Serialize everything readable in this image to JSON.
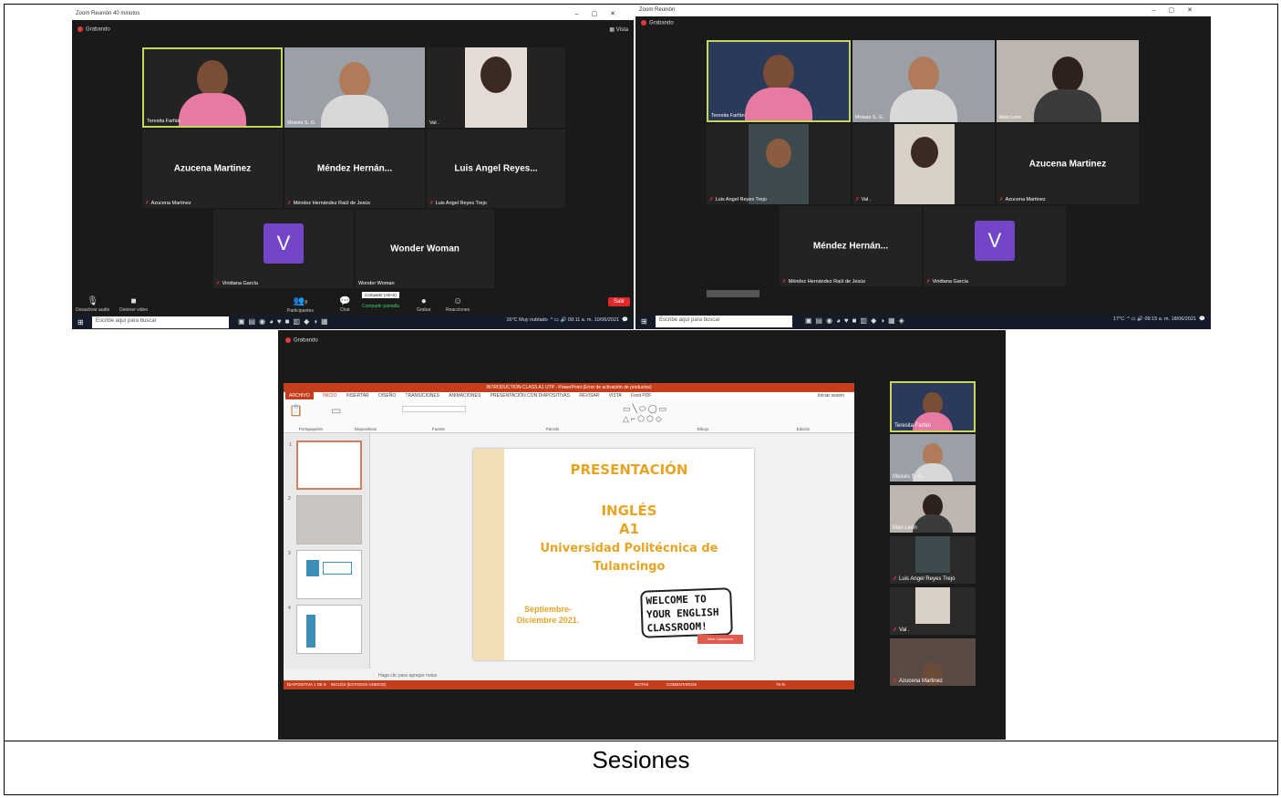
{
  "caption": "Sesiones",
  "screenshot_a": {
    "window_title": "Zoom Reunión 40 minutos",
    "recording": "Grabando",
    "view_label": "Vista",
    "participants": [
      {
        "name": "Teresita Farfán",
        "kind": "video",
        "active": true
      },
      {
        "name": "Moisés S. G.",
        "kind": "video"
      },
      {
        "name": "Val .",
        "kind": "video"
      },
      {
        "name": "Azucena Martinez",
        "display": "Azucena Martinez",
        "kind": "name"
      },
      {
        "name": "Méndez Hernández Raúl de Jesús",
        "display": "Méndez Hernán...",
        "kind": "name"
      },
      {
        "name": "Luis Angel Reyes Trejo",
        "display": "Luis Angel Reyes...",
        "kind": "name"
      },
      {
        "name": "Viridiana García",
        "display": "V",
        "kind": "avatar"
      },
      {
        "name": "Wonder Woman",
        "display": "Wonder Woman",
        "kind": "name"
      }
    ],
    "toolbar": {
      "audio": "Desactivar audio",
      "video": "Detener video",
      "participants": "Participantes",
      "participants_count": "8",
      "chat": "Chat",
      "share_tooltip": "Compartir (Alt+S)",
      "share": "Compartir pantalla",
      "record": "Grabar",
      "reactions": "Reacciones",
      "leave": "Salir"
    },
    "taskbar": {
      "search": "Escribe aquí para buscar",
      "weather": "16°C Muy nublado",
      "time": "09:11 a. m.",
      "date": "10/06/2021"
    }
  },
  "screenshot_b": {
    "window_title": "Zoom Reunión",
    "recording": "Grabando",
    "participants": [
      {
        "name": "Teresita Farfán",
        "kind": "video",
        "active": true
      },
      {
        "name": "Moisés S. G.",
        "kind": "video"
      },
      {
        "name": "Mari León",
        "kind": "video"
      },
      {
        "name": "Luis Angel Reyes Trejo",
        "kind": "video"
      },
      {
        "name": "Val .",
        "kind": "video"
      },
      {
        "name": "Azucena Martinez",
        "display": "Azucena Martinez",
        "kind": "name"
      },
      {
        "name": "Méndez Hernández Raúl de Jesús",
        "display": "Méndez Hernán...",
        "kind": "name"
      },
      {
        "name": "Viridiana García",
        "display": "V",
        "kind": "avatar"
      }
    ],
    "taskbar": {
      "search": "Escribe aquí para buscar",
      "weather": "17°C",
      "time": "09:15 a. m.",
      "date": "18/06/2021"
    }
  },
  "screenshot_c": {
    "recording": "Grabando",
    "ppt": {
      "title": "INTRODUCTION CLASS A1 UTP - PowerPoint (Error de activación de productos)",
      "tabs": [
        "ARCHIVO",
        "INICIO",
        "INSERTAR",
        "DISEÑO",
        "TRANSICIONES",
        "ANIMACIONES",
        "PRESENTACIÓN CON DIAPOSITIVAS",
        "REVISAR",
        "VISTA",
        "Foxit PDF"
      ],
      "signin": "Iniciar sesión",
      "groups": [
        "Portapapeles",
        "Diapositivas",
        "Fuente",
        "Párrafo",
        "Dibujo",
        "Edición"
      ],
      "slide": {
        "title": "PRESENTACIÓN",
        "lines": [
          "INGLÉS",
          "A1"
        ],
        "university": [
          "Universidad Politécnica de",
          "Tulancingo"
        ],
        "period": [
          "Septiembre-",
          "Diciembre 2021."
        ],
        "welcome": [
          "WELCOME TO",
          "YOUR ENGLISH",
          "CLASSROOM!"
        ],
        "tag": "New Classroom"
      },
      "notes": "Haga clic para agregar notas",
      "status": "DIAPOSITIVA 1 DE 8",
      "language": "INGLÉS (ESTADOS UNIDOS)",
      "notes_btn": "NOTAS",
      "comments_btn": "COMENTARIOS",
      "zoom": "76 %",
      "thumbnails": [
        "1",
        "2",
        "3",
        "4"
      ]
    },
    "participants": [
      {
        "name": "Teresita Farfán",
        "active": true
      },
      {
        "name": "Moisés S. G."
      },
      {
        "name": "Mari León"
      },
      {
        "name": "Luis Angel Reyes Trejo"
      },
      {
        "name": "Val ."
      },
      {
        "name": "Azucena Martinez"
      }
    ]
  }
}
